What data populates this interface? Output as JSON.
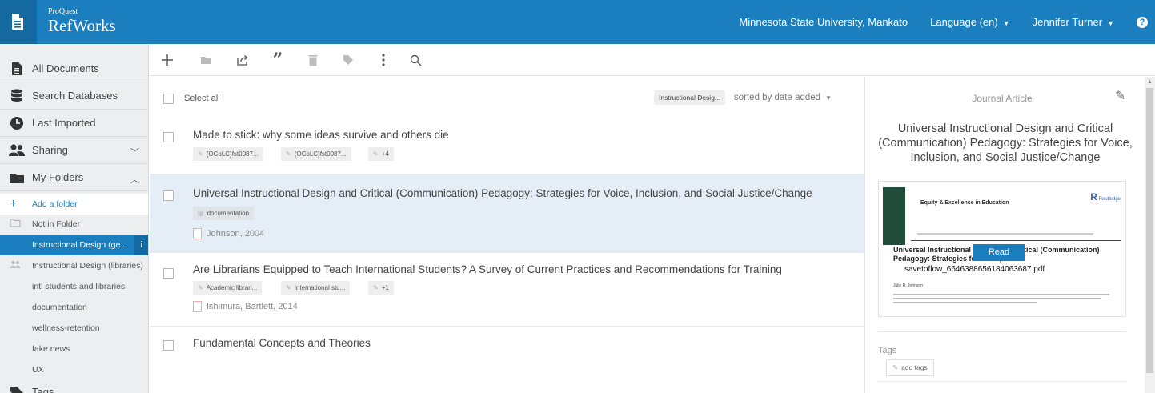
{
  "header": {
    "brand_small": "ProQuest",
    "brand_main": "RefWorks",
    "institution": "Minnesota State University, Mankato",
    "language": "Language (en)",
    "user": "Jennifer Turner",
    "help": "?"
  },
  "sidebar": {
    "nav": [
      {
        "label": "All Documents",
        "icon": "documents-icon"
      },
      {
        "label": "Search Databases",
        "icon": "database-icon"
      },
      {
        "label": "Last Imported",
        "icon": "clock-icon"
      },
      {
        "label": "Sharing",
        "icon": "users-icon",
        "chevron": "down"
      },
      {
        "label": "My Folders",
        "icon": "folder-icon",
        "chevron": "up"
      }
    ],
    "add_folder": "Add a folder",
    "not_in_folder": "Not in Folder",
    "folders": [
      {
        "label": "Instructional Design (ge...",
        "active": true
      },
      {
        "label": "Instructional Design (libraries)",
        "shared": true
      },
      {
        "label": "intl students and libraries"
      },
      {
        "label": "documentation"
      },
      {
        "label": "wellness-retention"
      },
      {
        "label": "fake news"
      },
      {
        "label": "UX"
      }
    ],
    "tags_label": "Tags"
  },
  "toolbar": {
    "icons": [
      "add-icon",
      "folder-icon",
      "share-icon",
      "cite-icon",
      "delete-icon",
      "tag-icon",
      "more-icon",
      "search-icon"
    ]
  },
  "list": {
    "select_all": "Select all",
    "filter_chip": "Instructional Desig...",
    "sorted_by": "sorted by",
    "sort_value": "date added",
    "documents": [
      {
        "title": "Made to stick: why some ideas survive and others die",
        "tags": [
          "(OCoLC)fst0087...",
          "(OCoLC)fst0087...",
          "+4"
        ],
        "author": ""
      },
      {
        "title": "Universal Instructional Design and Critical (Communication) Pedagogy: Strategies for Voice, Inclusion, and Social Justice/Change",
        "tags": [
          "documentation"
        ],
        "author": "Johnson, 2004",
        "selected": true
      },
      {
        "title": "Are Librarians Equipped to Teach International Students? A Survey of Current Practices and Recommendations for Training",
        "tags": [
          "Academic librari...",
          "International stu...",
          "+1"
        ],
        "author": "Ishimura, Bartlett, 2014"
      },
      {
        "title": "Fundamental Concepts and Theories",
        "tags": [],
        "author": ""
      }
    ]
  },
  "panel": {
    "type": "Journal Article",
    "title": "Universal Instructional Design and Critical (Communication) Pedagogy: Strategies for Voice, Inclusion, and Social Justice/Change",
    "preview": {
      "journal": "Equity & Excellence in Education",
      "publisher": "Routledge",
      "article_title": "Universal Instructional Design and Critical (Communication) Pedagogy: Strategies for Voice, Incl",
      "pdf_name": "savetoflow_6646388656184063687.pdf",
      "byline": "Julie R. Johnson",
      "read": "Read"
    },
    "tags_label": "Tags",
    "add_tags": "add tags"
  },
  "colors": {
    "brand_blue": "#1b7ebe",
    "brand_dark": "#1469a0",
    "selected_row": "#e5eef6"
  }
}
